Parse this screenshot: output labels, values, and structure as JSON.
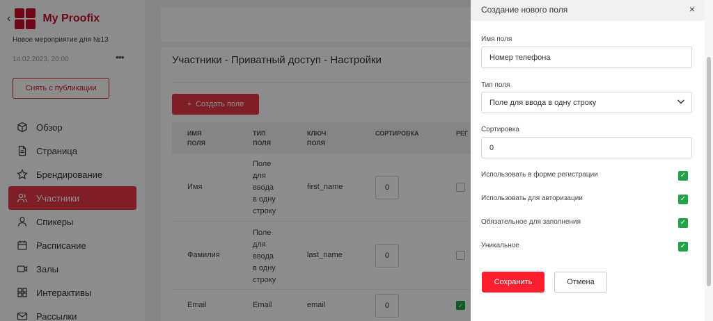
{
  "sidebar": {
    "back_glyph": "‹",
    "app_name": "My Proofix",
    "event_name": "Новое мероприятие для №13",
    "event_date": "14.02.2023, 20:00",
    "more_glyph": "•••",
    "unpublish_label": "Снять с публикации",
    "nav": [
      {
        "label": "Обзор",
        "icon": "cube-icon"
      },
      {
        "label": "Страница",
        "icon": "file-icon"
      },
      {
        "label": "Брендирование",
        "icon": "star-icon"
      },
      {
        "label": "Участники",
        "icon": "users-icon",
        "active": true
      },
      {
        "label": "Спикеры",
        "icon": "user-icon"
      },
      {
        "label": "Расписание",
        "icon": "calendar-icon"
      },
      {
        "label": "Залы",
        "icon": "video-icon"
      },
      {
        "label": "Интерактивы",
        "icon": "grid-icon"
      },
      {
        "label": "Рассылки",
        "icon": "mail-icon"
      }
    ]
  },
  "main": {
    "title": "Участники - Приватный доступ - Настройки",
    "create_label": "Создать поле",
    "headers": {
      "name": "ИМЯ\nПОЛЯ",
      "type": "ТИП\nПОЛЯ",
      "key": "КЛЮЧ\nПОЛЯ",
      "sort": "СОРТИРОВКА",
      "reg": "РЕГ"
    },
    "rows": [
      {
        "name": "Имя",
        "type": "Поле\nдля\nввода\nв одну\nстроку",
        "key": "first_name",
        "sort": "0",
        "reg": false
      },
      {
        "name": "Фамилия",
        "type": "Поле\nдля\nввода\nв одну\nстроку",
        "key": "last_name",
        "sort": "0",
        "reg": false
      },
      {
        "name": "Email",
        "type": "Email",
        "key": "email",
        "sort": "0",
        "reg": true
      }
    ]
  },
  "drawer": {
    "title": "Создание нового поля",
    "close_glyph": "×",
    "field_name_label": "Имя поля",
    "field_name_value": "Номер телефона",
    "field_type_label": "Тип поля",
    "field_type_value": "Поле для ввода в одну строку",
    "sort_label": "Сортировка",
    "sort_value": "0",
    "options": [
      {
        "label": "Использовать в форме регистрации",
        "checked": true
      },
      {
        "label": "Использовать для авторизации",
        "checked": true
      },
      {
        "label": "Обязательное для заполнения",
        "checked": true
      },
      {
        "label": "Уникальное",
        "checked": true
      }
    ],
    "save_label": "Сохранить",
    "cancel_label": "Отмена"
  },
  "colors": {
    "brand": "#c8102e",
    "accent": "#e53947",
    "save": "#ff1f2f",
    "check": "#22a34a"
  }
}
